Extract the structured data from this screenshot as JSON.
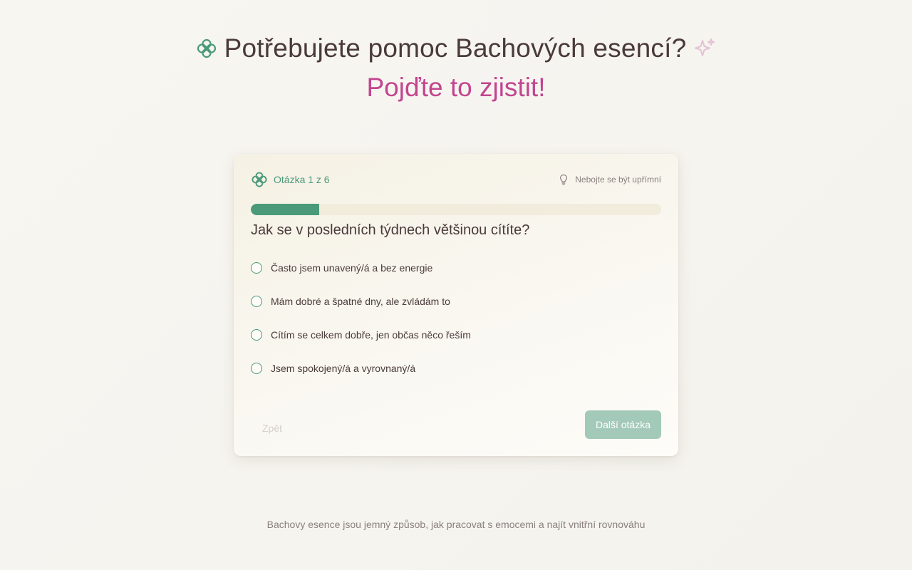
{
  "header": {
    "title": "Potřebujete pomoc Bachových esencí?",
    "subtitle": "Pojďte to zjistit!",
    "logo_icon": "flower-icon",
    "sparkle_icon": "sparkle-icon"
  },
  "quiz": {
    "question_counter": "Otázka 1 z 6",
    "hint": "Nebojte se být upřímní",
    "hint_icon": "lightbulb-icon",
    "progress": 0.1667,
    "question": "Jak se v posledních týdnech většinou cítíte?",
    "options": [
      {
        "label": "Často jsem unavený/á a bez energie",
        "selected": false
      },
      {
        "label": "Mám dobré a špatné dny, ale zvládám to",
        "selected": false
      },
      {
        "label": "Cítím se celkem dobře, jen občas něco řeším",
        "selected": false
      },
      {
        "label": "Jsem spokojený/á a vyrovnaný/á",
        "selected": false
      }
    ],
    "back_label": "Zpět",
    "next_label": "Další otázka"
  },
  "footer": {
    "text": "Bachovy esence jsou jemný způsob, jak pracovat s emocemi a najít vnitřní rovnováhu"
  },
  "colors": {
    "accent_green": "#4a9a7a",
    "accent_pink": "#c2458f",
    "text_dark": "#4a3a3a",
    "button_disabled": "#a3c9b8"
  }
}
